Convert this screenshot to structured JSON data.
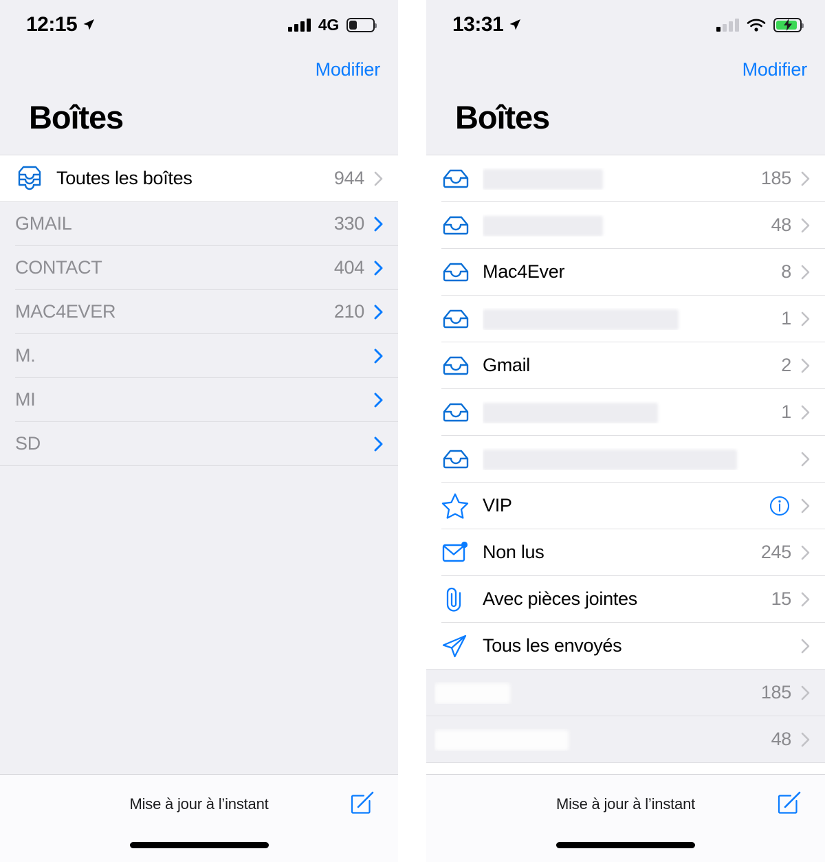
{
  "accent": "#0a7cff",
  "screens": [
    {
      "id": "left",
      "statusbar": {
        "time": "12:15",
        "location_icon": "location-arrow-icon",
        "signal_icon": "cellular-signal-icon",
        "signal_bars_filled": 4,
        "network": "4G",
        "battery_icon": "battery-low-icon",
        "battery_charging": false
      },
      "nav": {
        "edit_label": "Modifier",
        "title": "Boîtes"
      },
      "rows": [
        {
          "icon": "all-inboxes-icon",
          "label": "Toutes les boîtes",
          "count": "944",
          "chevron": "gray",
          "style": "white"
        },
        {
          "icon": "none",
          "label": "GMAIL",
          "count": "330",
          "chevron": "blue",
          "style": "muted"
        },
        {
          "icon": "none",
          "label": "CONTACT",
          "count": "404",
          "chevron": "blue",
          "style": "muted"
        },
        {
          "icon": "none",
          "label": "MAC4EVER",
          "count": "210",
          "chevron": "blue",
          "style": "muted"
        },
        {
          "icon": "none",
          "label": "M.",
          "count": "",
          "chevron": "blue",
          "style": "muted"
        },
        {
          "icon": "none",
          "label": "MI",
          "count": "",
          "chevron": "blue",
          "style": "muted"
        },
        {
          "icon": "none",
          "label": "SD",
          "count": "",
          "chevron": "blue",
          "style": "muted"
        }
      ],
      "footer": {
        "status_text": "Mise à jour à l’instant",
        "compose_icon": "compose-icon"
      }
    },
    {
      "id": "right",
      "statusbar": {
        "time": "13:31",
        "location_icon": "location-arrow-icon",
        "signal_icon": "cellular-signal-icon",
        "signal_bars_filled": 1,
        "network": "",
        "wifi_icon": "wifi-icon",
        "battery_icon": "battery-charging-icon",
        "battery_charging": true
      },
      "nav": {
        "edit_label": "Modifier",
        "title": "Boîtes"
      },
      "rows": [
        {
          "icon": "inbox-icon",
          "label": "",
          "redacted": true,
          "redact_width": 175,
          "count": "185",
          "chevron": "gray"
        },
        {
          "icon": "inbox-icon",
          "label": "",
          "redacted": true,
          "redact_width": 175,
          "count": "48",
          "chevron": "gray"
        },
        {
          "icon": "inbox-icon",
          "label": "Mac4Ever",
          "redacted": false,
          "count": "8",
          "chevron": "gray"
        },
        {
          "icon": "inbox-icon",
          "label": "",
          "redacted": true,
          "redact_width": 285,
          "count": "1",
          "chevron": "gray"
        },
        {
          "icon": "inbox-icon",
          "label": "Gmail",
          "redacted": false,
          "count": "2",
          "chevron": "gray"
        },
        {
          "icon": "inbox-icon",
          "label": "",
          "redacted": true,
          "redact_width": 255,
          "count": "1",
          "chevron": "gray"
        },
        {
          "icon": "inbox-icon",
          "label": "",
          "redacted": true,
          "redact_width": 370,
          "count": "",
          "chevron": "gray"
        },
        {
          "icon": "star-icon",
          "label": "VIP",
          "redacted": false,
          "count": "",
          "info": true,
          "chevron": "gray"
        },
        {
          "icon": "unread-envelope-icon",
          "label": "Non lus",
          "redacted": false,
          "count": "245",
          "chevron": "gray"
        },
        {
          "icon": "paperclip-icon",
          "label": "Avec pièces jointes",
          "redacted": false,
          "count": "15",
          "chevron": "gray"
        },
        {
          "icon": "paper-plane-icon",
          "label": "Tous les envoyés",
          "redacted": false,
          "count": "",
          "chevron": "gray"
        }
      ],
      "gray_rows": [
        {
          "label": "",
          "redacted": true,
          "redact_width": 110,
          "count": "185",
          "chevron": "gray"
        },
        {
          "label": "",
          "redacted": true,
          "redact_width": 195,
          "count": "48",
          "chevron": "gray"
        }
      ],
      "footer": {
        "status_text": "Mise à jour à l’instant",
        "compose_icon": "compose-icon"
      }
    }
  ]
}
